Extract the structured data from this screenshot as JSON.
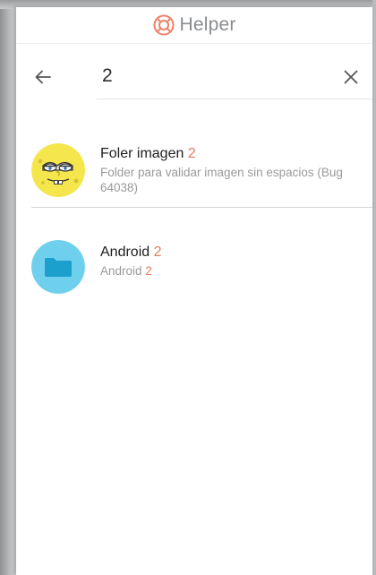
{
  "header": {
    "title": "Helper",
    "logo_icon": "lifebuoy-icon",
    "accent_color": "#f08068"
  },
  "search": {
    "query": "2",
    "back_icon": "arrow-left-icon",
    "clear_icon": "close-icon"
  },
  "results": [
    {
      "name": "Foler imagen",
      "match": "2",
      "subtitle": "Folder para validar imagen sin espacios (Bug 64038)",
      "avatar_icon": "sponge-character-avatar",
      "avatar_color": "#f4e64c"
    },
    {
      "name": "Android",
      "match": "2",
      "subtitle": "Android",
      "subtitle_match": "2",
      "avatar_icon": "folder-icon",
      "avatar_color": "#6fd0ee"
    }
  ],
  "colors": {
    "highlight": "#e57a5e",
    "caret": "#1aa0c8"
  }
}
